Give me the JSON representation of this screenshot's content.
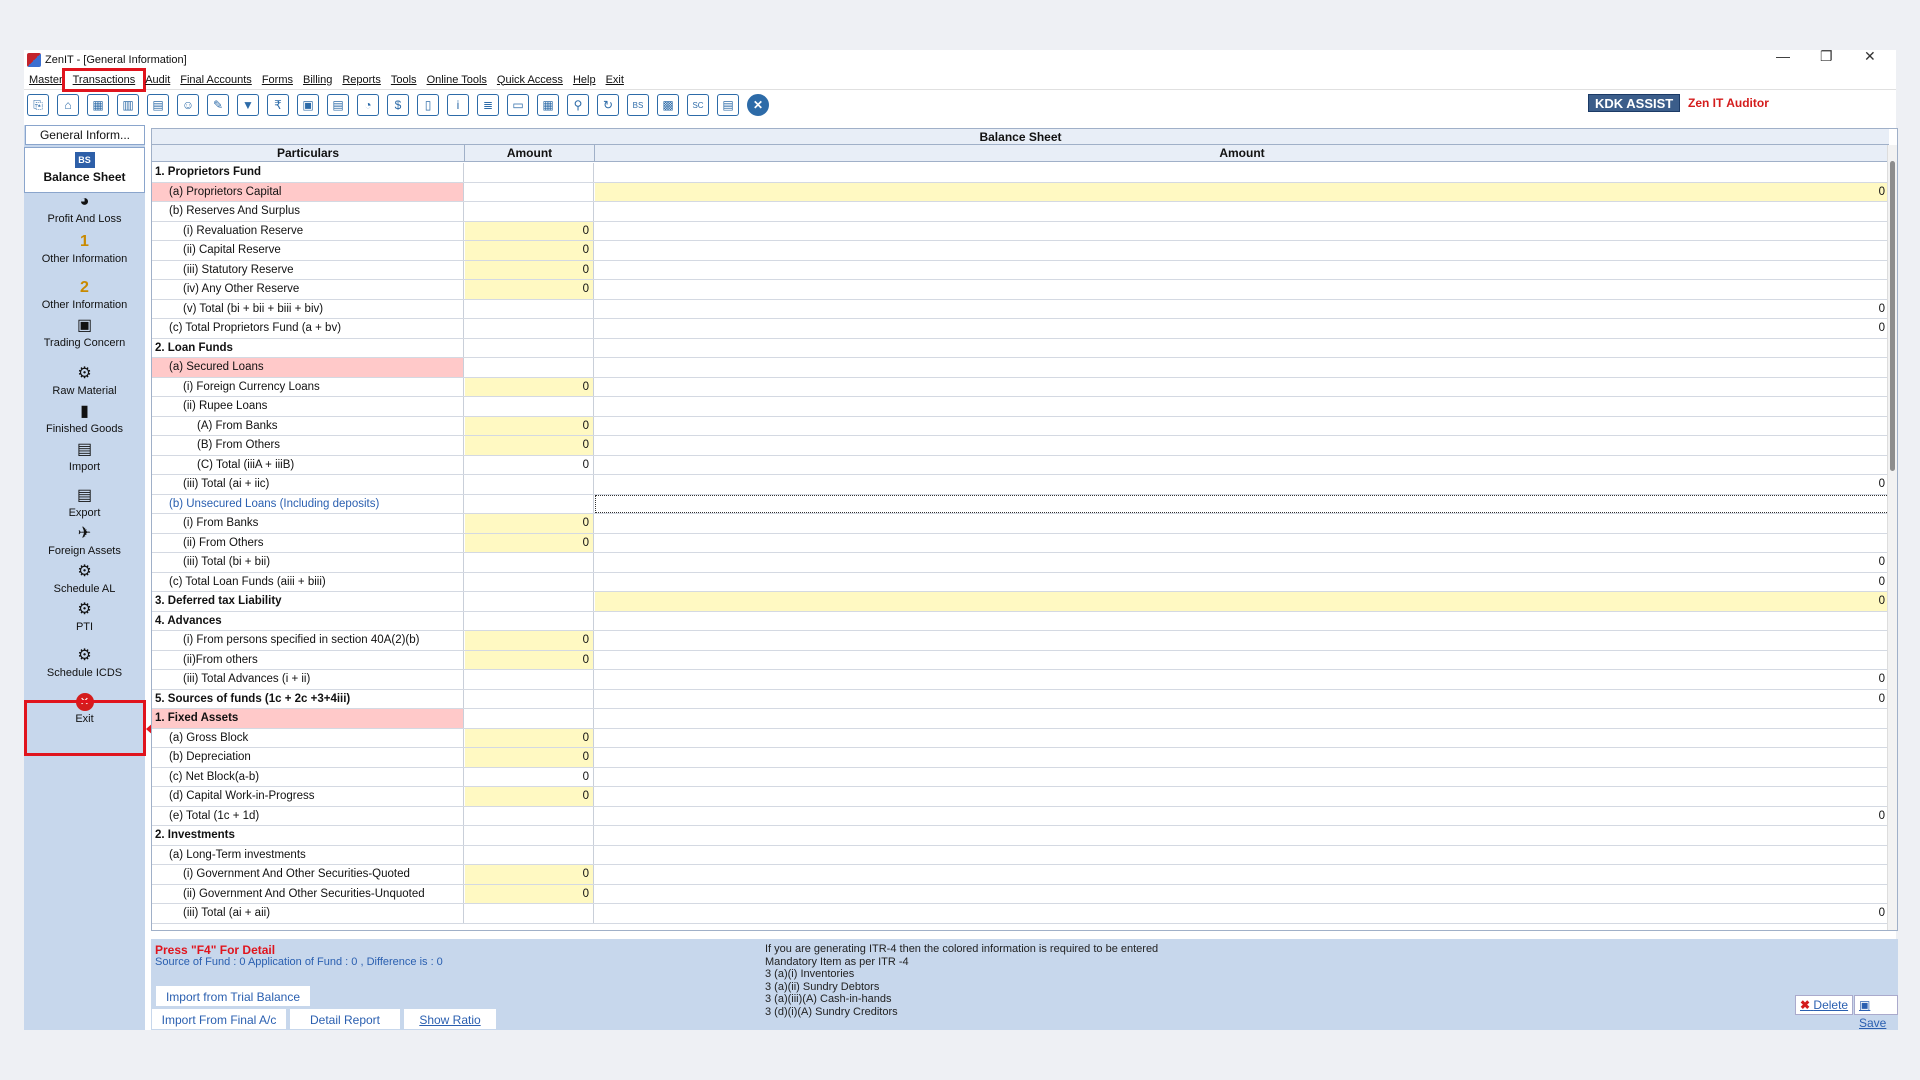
{
  "window": {
    "title": "ZenIT - [General Information]"
  },
  "menu": [
    "Master",
    "Transactions",
    "Audit",
    "Final Accounts",
    "Forms",
    "Billing",
    "Reports",
    "Tools",
    "Online Tools",
    "Quick Access",
    "Help",
    "Exit"
  ],
  "toolbar": {
    "icons": [
      "open-icon",
      "home-icon",
      "calculator-icon",
      "chart-icon",
      "gift-icon",
      "people-icon",
      "tools-icon",
      "filter-icon",
      "tax-icon",
      "disk-icon",
      "form-icon",
      "pie-icon",
      "pay-icon",
      "book-icon",
      "info-icon",
      "report-icon",
      "doc-icon",
      "calendar-icon",
      "map-icon",
      "refresh-icon",
      "bs-icon",
      "print-icon",
      "sco-icon",
      "ledger-icon",
      "close-icon"
    ],
    "glyphs": [
      "⎘",
      "⌂",
      "▦",
      "▥",
      "▤",
      "☺",
      "✎",
      "▼",
      "₹",
      "▣",
      "▤",
      "◔",
      "$",
      "▯",
      "i",
      "≣",
      "▭",
      "▦",
      "⚲",
      "↻",
      "BS",
      "▩",
      "SC",
      "▤",
      "✕"
    ],
    "kdk_label": "KDK ASSIST",
    "auditor_label": "Zen IT Auditor"
  },
  "sidebar": {
    "tab_label": "General Inform...",
    "items": [
      {
        "label": "Balance Sheet",
        "glyph": "BS"
      },
      {
        "label": "Profit And Loss",
        "glyph": "◕"
      },
      {
        "label": "Other Information",
        "glyph": "1"
      },
      {
        "label": "Other Information",
        "glyph": "2"
      },
      {
        "label": "Trading Concern",
        "glyph": "▣"
      },
      {
        "label": "Raw Material",
        "glyph": "⚙"
      },
      {
        "label": "Finished Goods",
        "glyph": "▮"
      },
      {
        "label": "Import",
        "glyph": "▤"
      },
      {
        "label": "Export",
        "glyph": "▤"
      },
      {
        "label": "Foreign Assets",
        "glyph": "✈"
      },
      {
        "label": "Schedule AL",
        "glyph": "⚙"
      },
      {
        "label": "PTI",
        "glyph": "⚙"
      },
      {
        "label": "Schedule ICDS",
        "glyph": "⚙"
      },
      {
        "label": "Exit",
        "glyph": "✕"
      }
    ]
  },
  "grid": {
    "title": "Balance Sheet",
    "col_particulars": "Particulars",
    "col_amount": "Amount",
    "col_amount2": "Amount",
    "rows": [
      {
        "label": "1. Proprietors Fund",
        "indent": 0,
        "bold": true,
        "amt": "",
        "total": "",
        "amt_bg": "",
        "total_bg": "",
        "label_bg": ""
      },
      {
        "label": "(a) Proprietors Capital",
        "indent": 1,
        "amt": "",
        "total": "0",
        "label_bg": "p",
        "total_bg": "y"
      },
      {
        "label": "(b) Reserves And Surplus",
        "indent": 1,
        "amt": "",
        "total": ""
      },
      {
        "label": "(i) Revaluation Reserve",
        "indent": 2,
        "amt": "0",
        "amt_bg": "y",
        "total": ""
      },
      {
        "label": "(ii) Capital Reserve",
        "indent": 2,
        "amt": "0",
        "amt_bg": "y",
        "total": ""
      },
      {
        "label": "(iii) Statutory Reserve",
        "indent": 2,
        "amt": "0",
        "amt_bg": "y",
        "total": ""
      },
      {
        "label": "(iv) Any Other Reserve",
        "indent": 2,
        "amt": "0",
        "amt_bg": "y",
        "total": ""
      },
      {
        "label": "(v) Total (bi + bii + biii + biv)",
        "indent": 2,
        "amt": "",
        "total": "0"
      },
      {
        "label": "(c) Total Proprietors Fund (a + bv)",
        "indent": 1,
        "amt": "",
        "total": "0"
      },
      {
        "label": "2. Loan Funds",
        "indent": 0,
        "bold": true,
        "amt": "",
        "total": ""
      },
      {
        "label": "(a) Secured Loans",
        "indent": 1,
        "amt": "",
        "total": "",
        "label_bg": "p"
      },
      {
        "label": "(i) Foreign Currency Loans",
        "indent": 2,
        "amt": "0",
        "amt_bg": "y",
        "total": ""
      },
      {
        "label": "(ii) Rupee Loans",
        "indent": 2,
        "amt": "",
        "total": ""
      },
      {
        "label": "(A) From Banks",
        "indent": 3,
        "amt": "0",
        "amt_bg": "y",
        "total": ""
      },
      {
        "label": "(B) From Others",
        "indent": 3,
        "amt": "0",
        "amt_bg": "y",
        "total": ""
      },
      {
        "label": "(C) Total (iiiA + iiiB)",
        "indent": 3,
        "amt": "0",
        "total": ""
      },
      {
        "label": "(iii) Total (ai + iic)",
        "indent": 2,
        "amt": "",
        "total": "0"
      },
      {
        "label": "(b) Unsecured Loans (Including deposits)",
        "indent": 1,
        "amt": "",
        "total": "",
        "blue": true,
        "sel": true
      },
      {
        "label": "(i) From Banks",
        "indent": 2,
        "amt": "0",
        "amt_bg": "y",
        "total": ""
      },
      {
        "label": "(ii) From Others",
        "indent": 2,
        "amt": "0",
        "amt_bg": "y",
        "total": ""
      },
      {
        "label": "(iii) Total (bi + bii)",
        "indent": 2,
        "amt": "",
        "total": "0"
      },
      {
        "label": "(c) Total Loan Funds (aiii + biii)",
        "indent": 1,
        "amt": "",
        "total": "0"
      },
      {
        "label": "3. Deferred tax Liability",
        "indent": 0,
        "bold": true,
        "amt": "",
        "total": "0",
        "total_bg": "y"
      },
      {
        "label": "4.  Advances",
        "indent": 0,
        "bold": true,
        "amt": "",
        "total": ""
      },
      {
        "label": "(i) From persons specified in section 40A(2)(b)",
        "indent": 2,
        "amt": "0",
        "amt_bg": "y",
        "total": ""
      },
      {
        "label": "(ii)From others",
        "indent": 2,
        "amt": "0",
        "amt_bg": "y",
        "total": ""
      },
      {
        "label": "(iii) Total Advances (i + ii)",
        "indent": 2,
        "amt": "",
        "total": "0"
      },
      {
        "label": "5. Sources of funds (1c + 2c +3+4iii)",
        "indent": 0,
        "bold": true,
        "amt": "",
        "total": "0"
      },
      {
        "label": "1. Fixed Assets",
        "indent": 0,
        "bold": true,
        "amt": "",
        "total": "",
        "label_bg": "p"
      },
      {
        "label": "(a) Gross Block",
        "indent": 1,
        "amt": "0",
        "amt_bg": "y",
        "total": ""
      },
      {
        "label": "(b) Depreciation",
        "indent": 1,
        "amt": "0",
        "amt_bg": "y",
        "total": ""
      },
      {
        "label": "(c) Net Block(a-b)",
        "indent": 1,
        "amt": "0",
        "total": ""
      },
      {
        "label": "(d) Capital Work-in-Progress",
        "indent": 1,
        "amt": "0",
        "amt_bg": "y",
        "total": ""
      },
      {
        "label": "(e) Total (1c + 1d)",
        "indent": 1,
        "amt": "",
        "total": "0"
      },
      {
        "label": "2. Investments",
        "indent": 0,
        "bold": true,
        "amt": "",
        "total": ""
      },
      {
        "label": "(a) Long-Term investments",
        "indent": 1,
        "amt": "",
        "total": ""
      },
      {
        "label": "(i) Government And Other Securities-Quoted",
        "indent": 2,
        "amt": "0",
        "amt_bg": "y",
        "total": ""
      },
      {
        "label": "(ii) Government And Other Securities-Unquoted",
        "indent": 2,
        "amt": "0",
        "amt_bg": "y",
        "total": ""
      },
      {
        "label": "(iii) Total (ai + aii)",
        "indent": 2,
        "amt": "",
        "total": "0"
      }
    ]
  },
  "footer": {
    "f4_hint": "Press \"F4\" For Detail",
    "fund_summary": "Source of Fund : 0 Application of Fund : 0 , Difference is : 0",
    "mandatory_note": "If you are generating ITR-4 then the colored information is required to be entered\nMandatory Item as per ITR -4\n3 (a)(i) Inventories\n3 (a)(ii) Sundry Debtors\n3 (a)(iii)(A) Cash-in-hands\n3 (d)(i)(A) Sundry Creditors",
    "import_trial": "Import from Trial Balance",
    "import_final": "Import From Final A/c",
    "detail_report": "Detail Report",
    "show_ratio": "Show Ratio",
    "delete": "Delete",
    "save": "Save"
  },
  "colors": {
    "highlight_red": "#e0141d",
    "input_yellow": "#fff9c2",
    "required_pink": "#ffc9c9",
    "sidebar_blue": "#c7d7ec"
  }
}
